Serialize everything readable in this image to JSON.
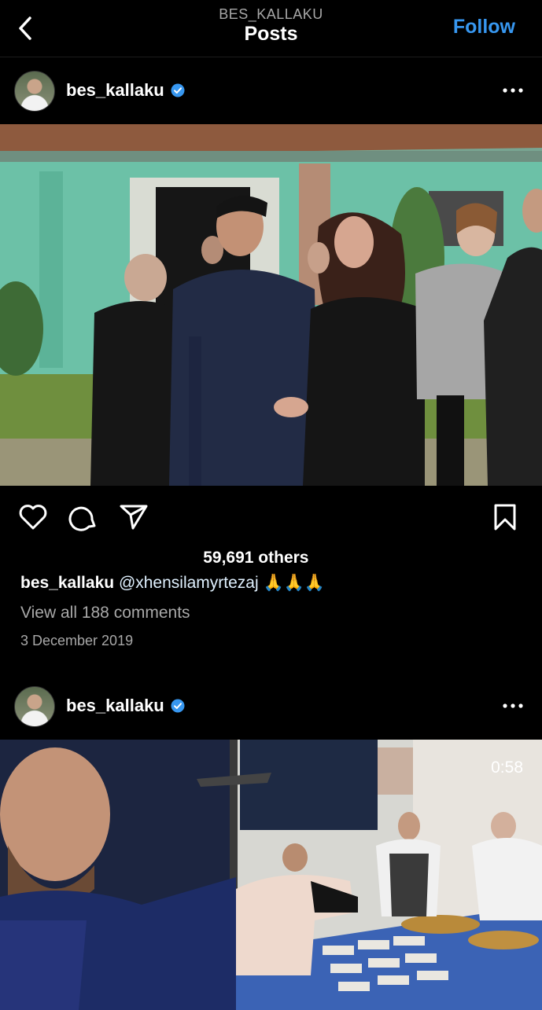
{
  "header": {
    "username": "BES_KALLAKU",
    "title": "Posts",
    "follow_label": "Follow"
  },
  "posts": [
    {
      "user": "bes_kallaku",
      "likes_text": "59,691 others",
      "caption_user": "bes_kallaku",
      "caption_mention": "@xhensilamyrtezaj",
      "caption_emoji": "🙏🙏🙏",
      "comments_label": "View all 188 comments",
      "date": "3 December 2019"
    },
    {
      "user": "bes_kallaku",
      "video_duration": "0:58"
    }
  ],
  "icons": {
    "back": "chevron-left-icon",
    "verified": "verified-badge-icon",
    "more": "more-horizontal-icon",
    "like": "heart-icon",
    "comment": "comment-icon",
    "share": "send-icon",
    "save": "bookmark-icon"
  },
  "colors": {
    "background": "#000000",
    "accent": "#3797f0",
    "secondary_text": "#a8a8a8"
  }
}
